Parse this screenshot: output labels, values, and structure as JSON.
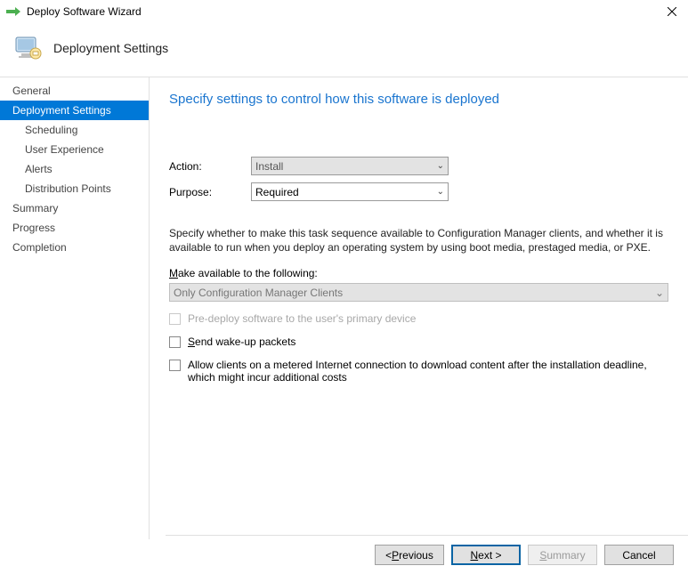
{
  "window": {
    "title": "Deploy Software Wizard"
  },
  "header": {
    "section": "Deployment Settings"
  },
  "sidebar": {
    "items": [
      {
        "label": "General",
        "sub": false
      },
      {
        "label": "Deployment Settings",
        "sub": false,
        "active": true
      },
      {
        "label": "Scheduling",
        "sub": true
      },
      {
        "label": "User Experience",
        "sub": true
      },
      {
        "label": "Alerts",
        "sub": true
      },
      {
        "label": "Distribution Points",
        "sub": true
      },
      {
        "label": "Summary",
        "sub": false
      },
      {
        "label": "Progress",
        "sub": false
      },
      {
        "label": "Completion",
        "sub": false
      }
    ]
  },
  "main": {
    "heading": "Specify settings to control how this software is deployed",
    "action_label": "Action:",
    "action_value": "Install",
    "purpose_label": "Purpose:",
    "purpose_value": "Required",
    "description": "Specify whether to make this task sequence available to Configuration Manager clients, and whether it is available to run when you deploy an operating system by using boot media, prestaged media, or PXE.",
    "available_label_pre": "M",
    "available_label_post": "ake available to the following:",
    "available_value": "Only Configuration Manager Clients",
    "cb_predeploy": "Pre-deploy software to the user's primary device",
    "cb_wakeup_pre": "S",
    "cb_wakeup_post": "end wake-up packets",
    "cb_metered": "Allow clients on a metered Internet connection to download content after the installation deadline, which might incur additional costs"
  },
  "footer": {
    "previous_pre": "< ",
    "previous_u": "P",
    "previous_post": "revious",
    "next_u": "N",
    "next_post": "ext >",
    "summary_u": "S",
    "summary_post": "ummary",
    "cancel": "Cancel"
  }
}
